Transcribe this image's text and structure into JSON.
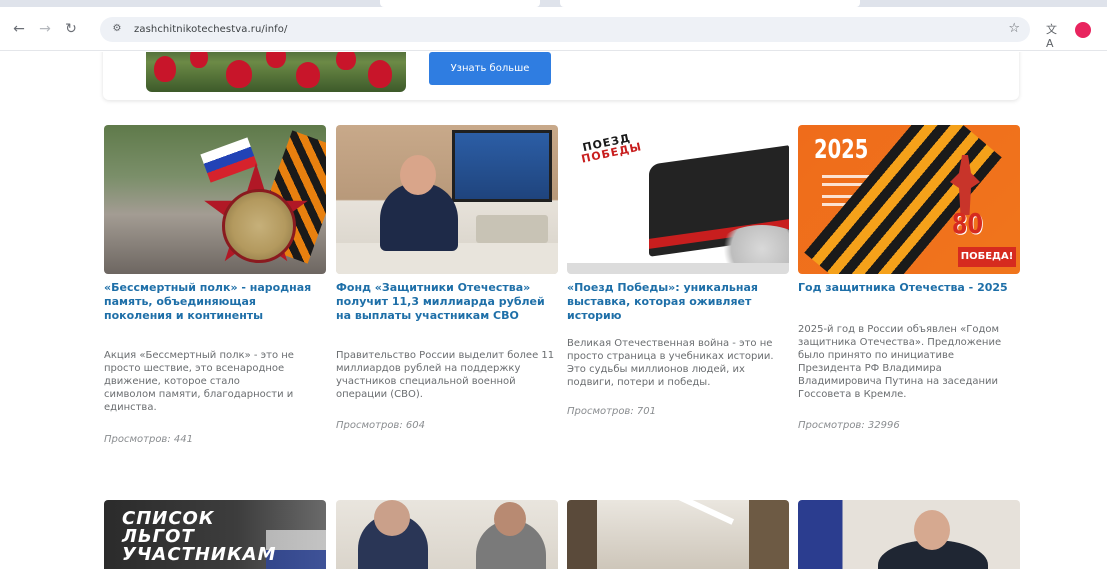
{
  "browser": {
    "url": "zashchitnikotechestva.ru/info/",
    "back_icon": "arrow-left-icon",
    "forward_icon": "arrow-right-icon",
    "reload_icon": "reload-icon",
    "bookmark_icon": "star-icon",
    "translate_icon": "translate-icon",
    "profile_initial": "●"
  },
  "banner": {
    "button_label": "Узнать больше"
  },
  "cards": [
    {
      "title": "«Бессмертный полк» - народная память, объединяющая поколения и континенты",
      "text": "Акция «Бессмертный полк» - это не просто шествие, это всенародное движение, которое стало символом памяти, благодарности и единства.",
      "views": "Просмотров: 441"
    },
    {
      "title": "Фонд «Защитники Отечества» получит 11,3 миллиарда рублей на выплаты участникам СВО",
      "text": "Правительство России выделит более 11 миллиардов рублей на поддержку участников специальной военной операции (СВО).",
      "views": "Просмотров: 604"
    },
    {
      "title": "«Поезд Победы»: уникальная выставка, которая оживляет историю",
      "text": "Великая Отечественная война - это не просто страница в учебниках истории. Это судьбы миллионов людей, их подвиги, потери и победы.",
      "views": "Просмотров: 701"
    },
    {
      "title": "Год защитника Отечества - 2025",
      "text": "2025-й год в России объявлен «Годом защитника Отечества». Предложение было принято по инициативе Президента РФ Владимира Владимировича Путина на заседании Госсовета в Кремле.",
      "views": "Просмотров: 32996"
    }
  ],
  "card_images": {
    "train_logo_top": "ПОЕЗД",
    "train_logo_bottom": "ПОБЕДЫ",
    "year_label": "2025",
    "anniversary": "80",
    "pobeda_label": "ПОБЕДА!"
  },
  "second_row": {
    "card1_text": "СПИСОК ЛЬГОТ УЧАСТНИКАМ"
  },
  "colors": {
    "title_blue": "#1e6fa8",
    "button_blue": "#2f7de1"
  }
}
